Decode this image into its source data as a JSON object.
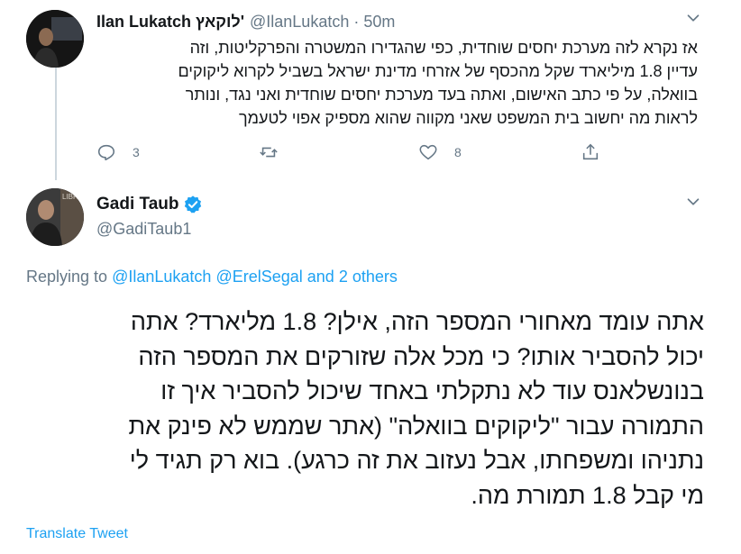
{
  "tweet1": {
    "display_name": "Ilan Lukatch לוקאץ'",
    "handle": "@IlanLukatch",
    "separator": "·",
    "time": "50m",
    "text_lines": [
      "אז נקרא לזה מערכת יחסים שוחדית, כפי שהגדירו המשטרה והפרקליטות, וזה",
      "עדיין 1.8 מיליארד שקל מהכסף של אזרחי מדינת ישראל בשביל לקרוא ליקוקים",
      "בוואלה, על פי כתב האישום, ואתה בעד מערכת יחסים שוחדית ואני נגד, ונותר",
      "לראות מה יחשוב בית המשפט שאני מקווה שהוא מספיק אפוי לטעמך"
    ],
    "actions": {
      "reply_count": "3",
      "retweet_count": "",
      "like_count": "8"
    }
  },
  "tweet2": {
    "display_name": "Gadi Taub",
    "handle": "@GadiTaub1",
    "replying_prefix": "Replying to",
    "replying_user1": "@IlanLukatch",
    "replying_user2": "@ErelSegal",
    "replying_suffix": "and 2 others",
    "text_lines": [
      "אתה עומד מאחורי המספר הזה, אילן? 1.8 מליארד? אתה",
      "יכול להסביר אותו? כי מכל אלה שזורקים את המספר הזה",
      "בנונשלאנס עוד לא נתקלתי באחד שיכול להסביר איך זו",
      "התמורה עבור \"ליקוקים בוואלה\" (אתר שממש לא פינק את",
      "נתניהו ומשפחתו, אבל נעזוב את זה כרגע). בוא רק תגיד לי",
      "מי קבל 1.8 תמורת מה."
    ],
    "translate_label": "Translate Tweet"
  },
  "icons": {
    "chevron": "chevron-down-icon",
    "reply": "reply-icon",
    "retweet": "retweet-icon",
    "like": "like-icon",
    "share": "share-icon",
    "verified": "verified-badge-icon"
  },
  "colors": {
    "accent": "#1da1f2",
    "secondary_text": "#657786",
    "primary_text": "#14171a",
    "thread_line": "#ccd6dd"
  }
}
